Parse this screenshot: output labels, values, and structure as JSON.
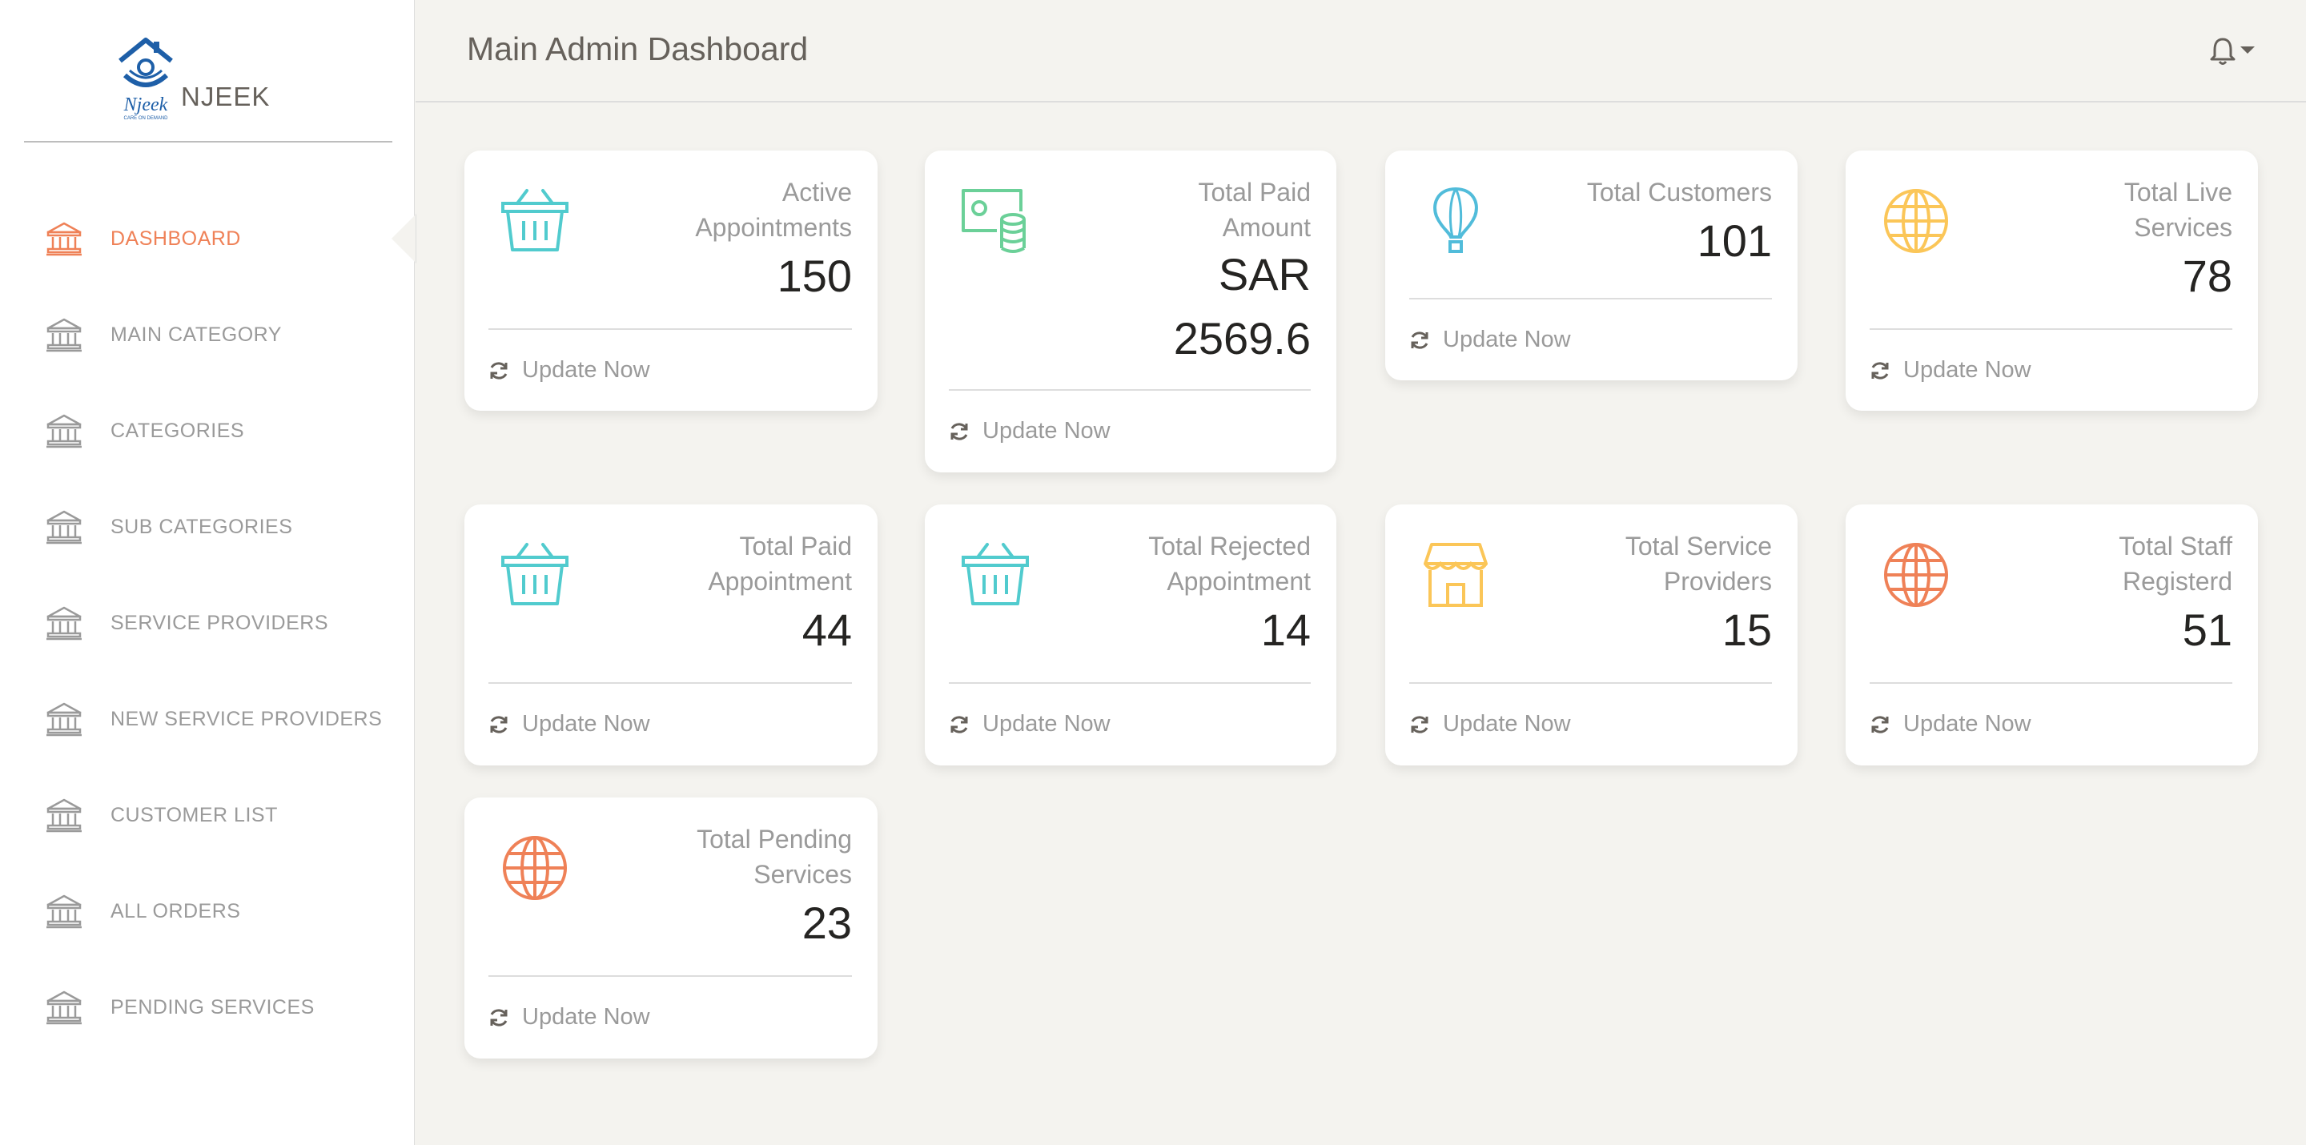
{
  "brand": {
    "name": "NJEEK",
    "logo_text": "Njeek",
    "logo_tagline": "CARE ON DEMAND"
  },
  "header": {
    "title": "Main Admin Dashboard",
    "notification_icon": "bell-icon"
  },
  "colors": {
    "accent_orange": "#ef8157",
    "teal": "#51cbce",
    "green": "#6bd098",
    "blue": "#51bcda",
    "yellow": "#fbc658"
  },
  "sidebar": {
    "items": [
      {
        "label": "DASHBOARD",
        "icon": "bank-icon",
        "active": true
      },
      {
        "label": "MAIN CATEGORY",
        "icon": "bank-icon"
      },
      {
        "label": "CATEGORIES",
        "icon": "bank-icon"
      },
      {
        "label": "SUB CATEGORIES",
        "icon": "bank-icon"
      },
      {
        "label": "SERVICE PROVIDERS",
        "icon": "bank-icon"
      },
      {
        "label": "NEW SERVICE PROVIDERS",
        "icon": "bank-icon"
      },
      {
        "label": "CUSTOMER LIST",
        "icon": "bank-icon"
      },
      {
        "label": "ALL ORDERS",
        "icon": "bank-icon"
      },
      {
        "label": "PENDING SERVICES",
        "icon": "bank-icon"
      }
    ]
  },
  "cards": [
    {
      "title_line1": "Active",
      "title_line2": "Appointments",
      "value": "150",
      "footer": "Update Now",
      "icon": "basket-icon"
    },
    {
      "title_line1": "Total Paid",
      "title_line2": "Amount",
      "value_line1": "SAR",
      "value": "2569.6",
      "footer": "Update Now",
      "icon": "money-coins-icon"
    },
    {
      "title_line1": "Total Customers",
      "value": "101",
      "footer": "Update Now",
      "icon": "balloon-icon"
    },
    {
      "title_line1": "Total Live",
      "title_line2": "Services",
      "value": "78",
      "footer": "Update Now",
      "icon": "globe-icon"
    },
    {
      "title_line1": "Total Paid",
      "title_line2": "Appointment",
      "value": "44",
      "footer": "Update Now",
      "icon": "basket-icon"
    },
    {
      "title_line1": "Total Rejected",
      "title_line2": "Appointment",
      "value": "14",
      "footer": "Update Now",
      "icon": "basket-icon"
    },
    {
      "title_line1": "Total Service",
      "title_line2": "Providers",
      "value": "15",
      "footer": "Update Now",
      "icon": "shop-icon"
    },
    {
      "title_line1": "Total Staff",
      "title_line2": "Registerd",
      "value": "51",
      "footer": "Update Now",
      "icon": "globe-icon"
    },
    {
      "title_line1": "Total Pending",
      "title_line2": "Services",
      "value": "23",
      "footer": "Update Now",
      "icon": "globe-icon"
    }
  ]
}
